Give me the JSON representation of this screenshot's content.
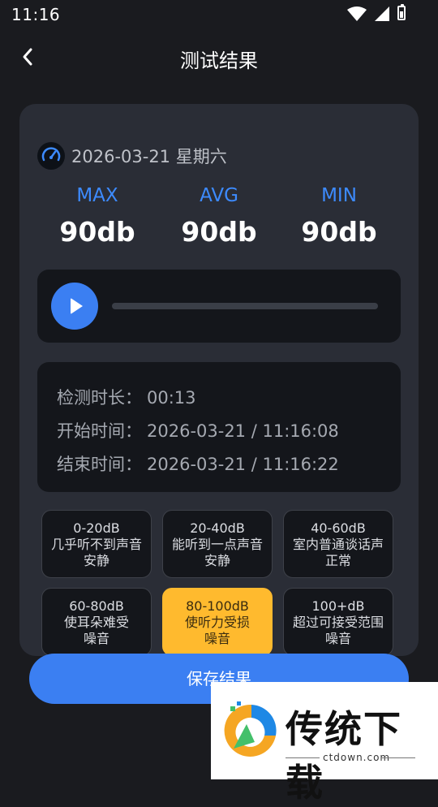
{
  "status_bar": {
    "time": "11:16"
  },
  "nav": {
    "title": "测试结果"
  },
  "card": {
    "date": "2026-03-21 星期六",
    "stats": [
      {
        "label": "MAX",
        "value": "90db"
      },
      {
        "label": "AVG",
        "value": "90db"
      },
      {
        "label": "MIN",
        "value": "90db"
      }
    ],
    "player": {
      "progress": 0
    },
    "info": [
      {
        "key": "检测时长：",
        "value": "00:13"
      },
      {
        "key": "开始时间：",
        "value": "2026-03-21 / 11:16:08"
      },
      {
        "key": "结束时间：",
        "value": "2026-03-21 / 11:16:22"
      }
    ],
    "levels": [
      {
        "range": "0-20dB",
        "line1": "几乎听不到声音",
        "line2": "安静",
        "highlighted": false
      },
      {
        "range": "20-40dB",
        "line1": "能听到一点声音",
        "line2": "安静",
        "highlighted": false
      },
      {
        "range": "40-60dB",
        "line1": "室内普通谈话声",
        "line2": "正常",
        "highlighted": false
      },
      {
        "range": "60-80dB",
        "line1": "使耳朵难受",
        "line2": "噪音",
        "highlighted": false
      },
      {
        "range": "80-100dB",
        "line1": "使听力受损",
        "line2": "噪音",
        "highlighted": true
      },
      {
        "range": "100+dB",
        "line1": "超过可接受范围",
        "line2": "噪音",
        "highlighted": false
      }
    ]
  },
  "save_button": {
    "label": "保存结果"
  },
  "watermark": {
    "brand": "传统下载",
    "site": "ctdown.com"
  },
  "colors": {
    "accent": "#3b7ff2",
    "highlight": "#ffba2e",
    "card": "#2a2d36",
    "background": "#1a1b1f"
  }
}
